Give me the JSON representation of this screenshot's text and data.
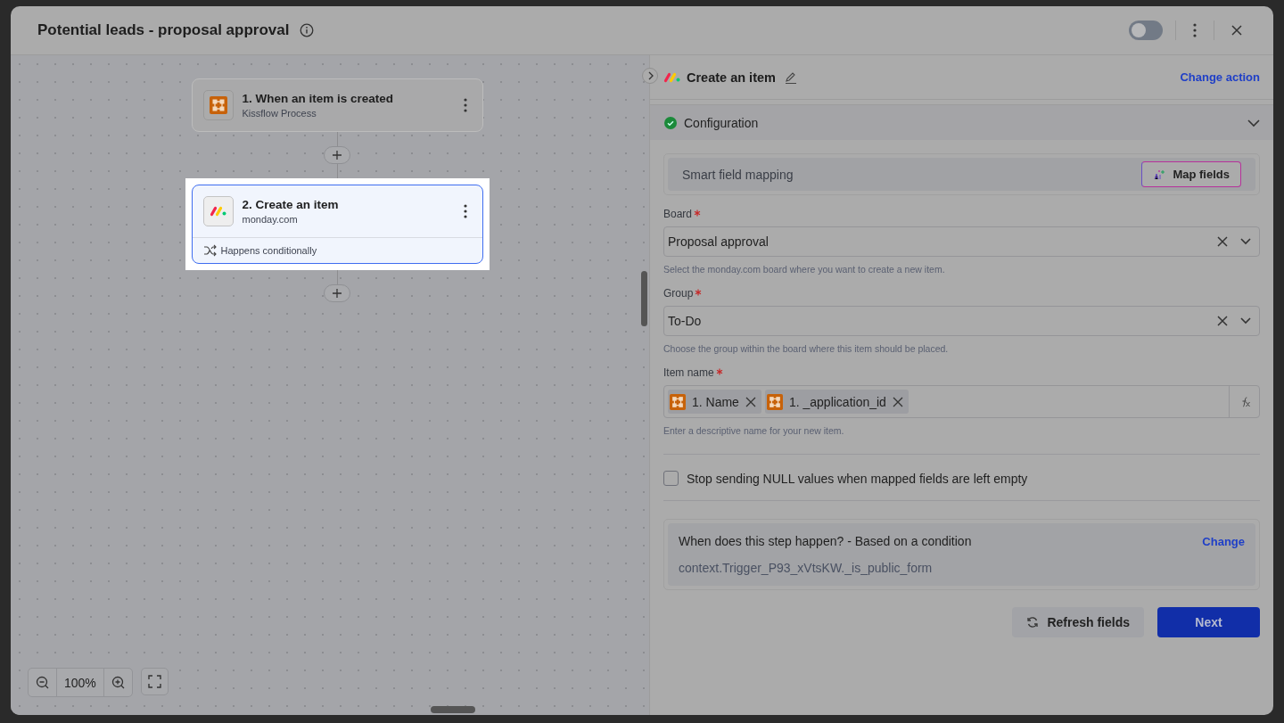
{
  "window": {
    "title": "Potential leads - proposal approval",
    "workflow_on": false
  },
  "steps": [
    {
      "title": "1. When an item is created",
      "app": "Kissflow Process",
      "kind": "kissflow",
      "selected": false
    },
    {
      "title": "2. Create an item",
      "app": "monday.com",
      "kind": "monday",
      "selected": true,
      "condition": "Happens conditionally"
    }
  ],
  "zoom": {
    "value": "100%"
  },
  "panel": {
    "title": "Create an item",
    "kind": "monday",
    "change_action": "Change action",
    "section": {
      "title": "Configuration",
      "complete": true,
      "expanded": true
    },
    "smart_mapping": {
      "label": "Smart field mapping",
      "button": "Map fields"
    },
    "fields": [
      {
        "kind": "select",
        "label": "Board",
        "required": true,
        "value": "Proposal approval",
        "help": "Select the monday.com board where you want to create a new item."
      },
      {
        "kind": "select",
        "label": "Group",
        "required": true,
        "value": "To-Do",
        "help": "Choose the group within the board where this item should be placed."
      },
      {
        "kind": "tokens",
        "label": "Item name",
        "required": true,
        "tokens": [
          {
            "text": "1. Name",
            "kind": "kissflow"
          },
          {
            "text": "1. _application_id",
            "kind": "kissflow"
          }
        ],
        "help": "Enter a descriptive name for your new item."
      }
    ],
    "null_option": {
      "label": "Stop sending NULL values when mapped fields are left empty",
      "checked": false
    },
    "condition": {
      "title": "When does this step happen? - Based on a condition",
      "change": "Change",
      "expression": "context.Trigger_P93_xVtsKW._is_public_form"
    },
    "buttons": [
      {
        "kind": "refresh",
        "label": "Refresh fields"
      },
      {
        "kind": "primary",
        "label": "Next"
      }
    ]
  }
}
